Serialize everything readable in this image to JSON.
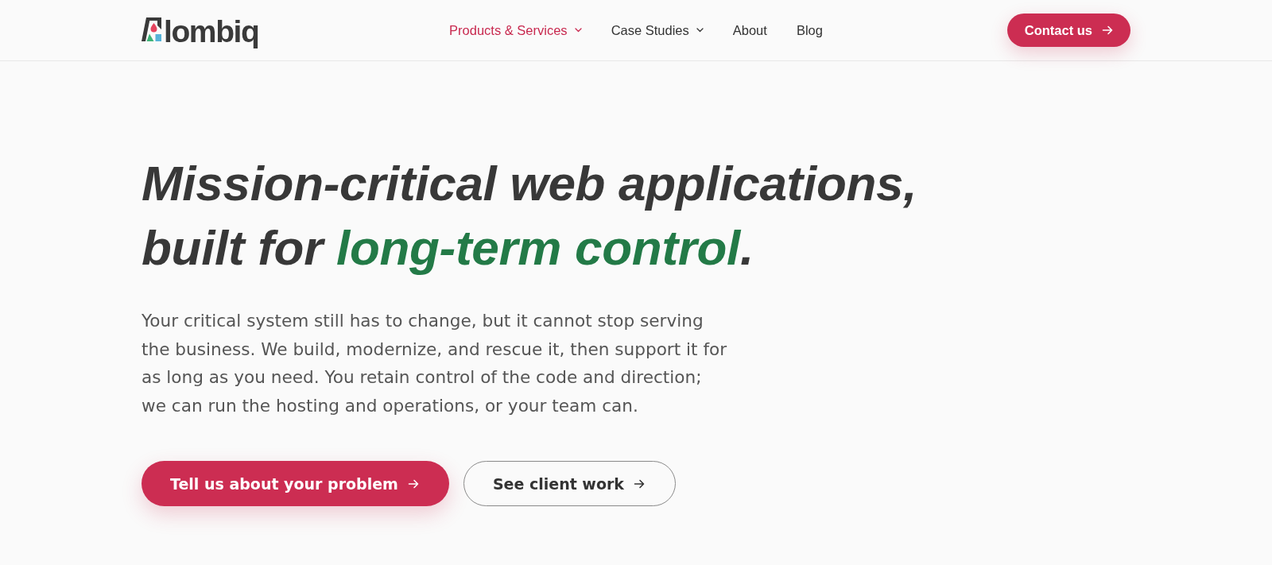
{
  "header": {
    "logo": {
      "text": "lombiq"
    },
    "nav": [
      {
        "label": "Products & Services",
        "kind": "dropdown",
        "selected": true
      },
      {
        "label": "Case Studies",
        "kind": "dropdown",
        "selected": false
      },
      {
        "label": "About",
        "kind": "link",
        "selected": false
      },
      {
        "label": "Blog",
        "kind": "link",
        "selected": false
      }
    ],
    "cta": {
      "label": "Contact us"
    }
  },
  "hero": {
    "headline": [
      {
        "text": "Mission-critical web applications, built for ",
        "highlight": false
      },
      {
        "text": "long-term control",
        "highlight": true
      },
      {
        "text": ".",
        "highlight": false
      }
    ],
    "body": "Your critical system still has to change, but it cannot stop serving the business. We build, modernize, and rescue it, then support it for as long as you need. You retain control of the code and direction; we can run the hosting and operations, or your team can.",
    "buttons": [
      {
        "label": "Tell us about your problem",
        "kind": "primary"
      },
      {
        "label": "See client work",
        "kind": "secondary"
      }
    ]
  }
}
